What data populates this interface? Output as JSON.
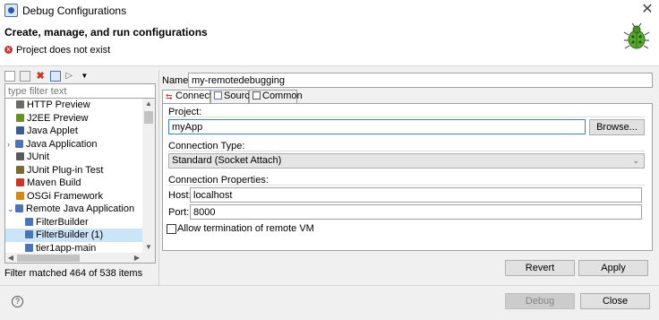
{
  "window": {
    "title": "Debug Configurations"
  },
  "header": {
    "title": "Create, manage, and run configurations",
    "message": "Project does not exist"
  },
  "left_panel": {
    "filter_placeholder": "type filter text",
    "items": [
      {
        "label": "HTTP Preview",
        "icon": "http-preview-icon",
        "color": "#6a6a6a",
        "indent": 1,
        "chevron": ""
      },
      {
        "label": "J2EE Preview",
        "icon": "j2ee-preview-icon",
        "color": "#6a8f2a",
        "indent": 1,
        "chevron": ""
      },
      {
        "label": "Java Applet",
        "icon": "java-applet-icon",
        "color": "#3d5c8c",
        "indent": 1,
        "chevron": ""
      },
      {
        "label": "Java Application",
        "icon": "java-application-icon",
        "color": "#4a74b5",
        "indent": 0,
        "chevron": "›"
      },
      {
        "label": "JUnit",
        "icon": "junit-icon",
        "color": "#5a5a5a",
        "indent": 1,
        "chevron": ""
      },
      {
        "label": "JUnit Plug-in Test",
        "icon": "junit-plugin-icon",
        "color": "#7a6a3a",
        "indent": 1,
        "chevron": ""
      },
      {
        "label": "Maven Build",
        "icon": "maven-icon",
        "color": "#c0392b",
        "indent": 1,
        "chevron": ""
      },
      {
        "label": "OSGi Framework",
        "icon": "osgi-icon",
        "color": "#d08a20",
        "indent": 1,
        "chevron": ""
      },
      {
        "label": "Remote Java Application",
        "icon": "remote-java-icon",
        "color": "#4a74b5",
        "indent": 0,
        "chevron": "⌄"
      },
      {
        "label": "FilterBuilder",
        "icon": "remote-config-icon",
        "color": "#4a74b5",
        "indent": 2,
        "chevron": ""
      },
      {
        "label": "FilterBuilder (1)",
        "icon": "remote-config-icon",
        "color": "#4a74b5",
        "indent": 2,
        "chevron": "",
        "selected": true
      },
      {
        "label": "tier1app-main",
        "icon": "remote-config-icon",
        "color": "#4a74b5",
        "indent": 2,
        "chevron": ""
      }
    ],
    "filter_status": "Filter matched 464 of 538 items"
  },
  "config": {
    "name_label": "Name:",
    "name_value": "my-remotedebugging",
    "tabs": [
      {
        "label": "Connect",
        "icon": "connect-icon",
        "active": true
      },
      {
        "label": "Source",
        "icon": "source-icon",
        "active": false
      },
      {
        "label": "Common",
        "icon": "common-icon",
        "active": false
      }
    ],
    "project_label": "Project:",
    "project_value": "myApp",
    "browse_label": "Browse...",
    "connection_type_label": "Connection Type:",
    "connection_type_value": "Standard (Socket Attach)",
    "connection_props_label": "Connection Properties:",
    "host_label": "Host:",
    "host_value": "localhost",
    "port_label": "Port:",
    "port_value": "8000",
    "allow_termination_label": "Allow termination of remote VM",
    "allow_termination_checked": false
  },
  "buttons": {
    "revert": "Revert",
    "apply": "Apply",
    "debug": "Debug",
    "close": "Close"
  },
  "colors": {
    "selection": "#cce4f7",
    "focus_border": "#3c7fd1",
    "error": "#d03030"
  }
}
